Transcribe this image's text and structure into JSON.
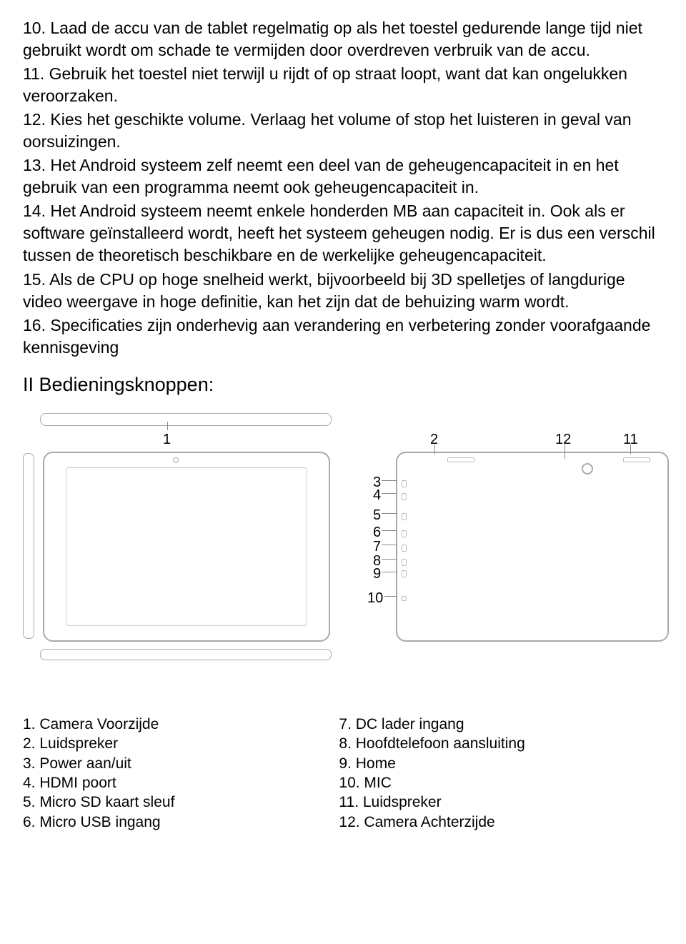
{
  "paragraphs": {
    "p10": "10. Laad de accu van de tablet regelmatig op als het toestel gedurende lange tijd niet gebruikt wordt om schade te vermijden door overdreven verbruik van de accu.",
    "p11": "11. Gebruik het toestel niet terwijl u rijdt of op straat loopt, want dat kan ongelukken veroorzaken.",
    "p12": "12. Kies het geschikte volume. Verlaag het volume of stop het luisteren in geval van oorsuizingen.",
    "p13": "13. Het Android systeem zelf neemt een deel van de geheugencapaciteit in en het gebruik van een programma neemt ook geheugencapaciteit in.",
    "p14": "14. Het Android systeem neemt enkele honderden MB aan capaciteit  in. Ook als er software geïnstalleerd wordt, heeft het systeem geheugen nodig. Er is dus een verschil tussen de theoretisch beschikbare en de werkelijke geheugencapaciteit.",
    "p15": "15. Als de CPU op hoge snelheid werkt, bijvoorbeeld bij 3D spelletjes  of langdurige video weergave in hoge definitie, kan het zijn dat de behuizing warm wordt.",
    "p16": "16. Specificaties zijn onderhevig aan verandering en verbetering zonder voorafgaande kennisgeving"
  },
  "section_title": "II Bedieningsknoppen:",
  "diagram_labels": {
    "n1": "1",
    "n2": "2",
    "n3": "3",
    "n4": "4",
    "n5": "5",
    "n6": "6",
    "n7": "7",
    "n8": "8",
    "n9": "9",
    "n10": "10",
    "n11": "11",
    "n12": "12"
  },
  "legend_left": [
    "1. Camera Voorzijde",
    "2. Luidspreker",
    "3. Power aan/uit",
    "4. HDMI poort",
    "5. Micro SD kaart sleuf",
    "6. Micro USB ingang"
  ],
  "legend_right": [
    "7. DC lader ingang",
    "8. Hoofdtelefoon aansluiting",
    "9. Home",
    "10. MIC",
    "11. Luidspreker",
    "12. Camera Achterzijde"
  ]
}
